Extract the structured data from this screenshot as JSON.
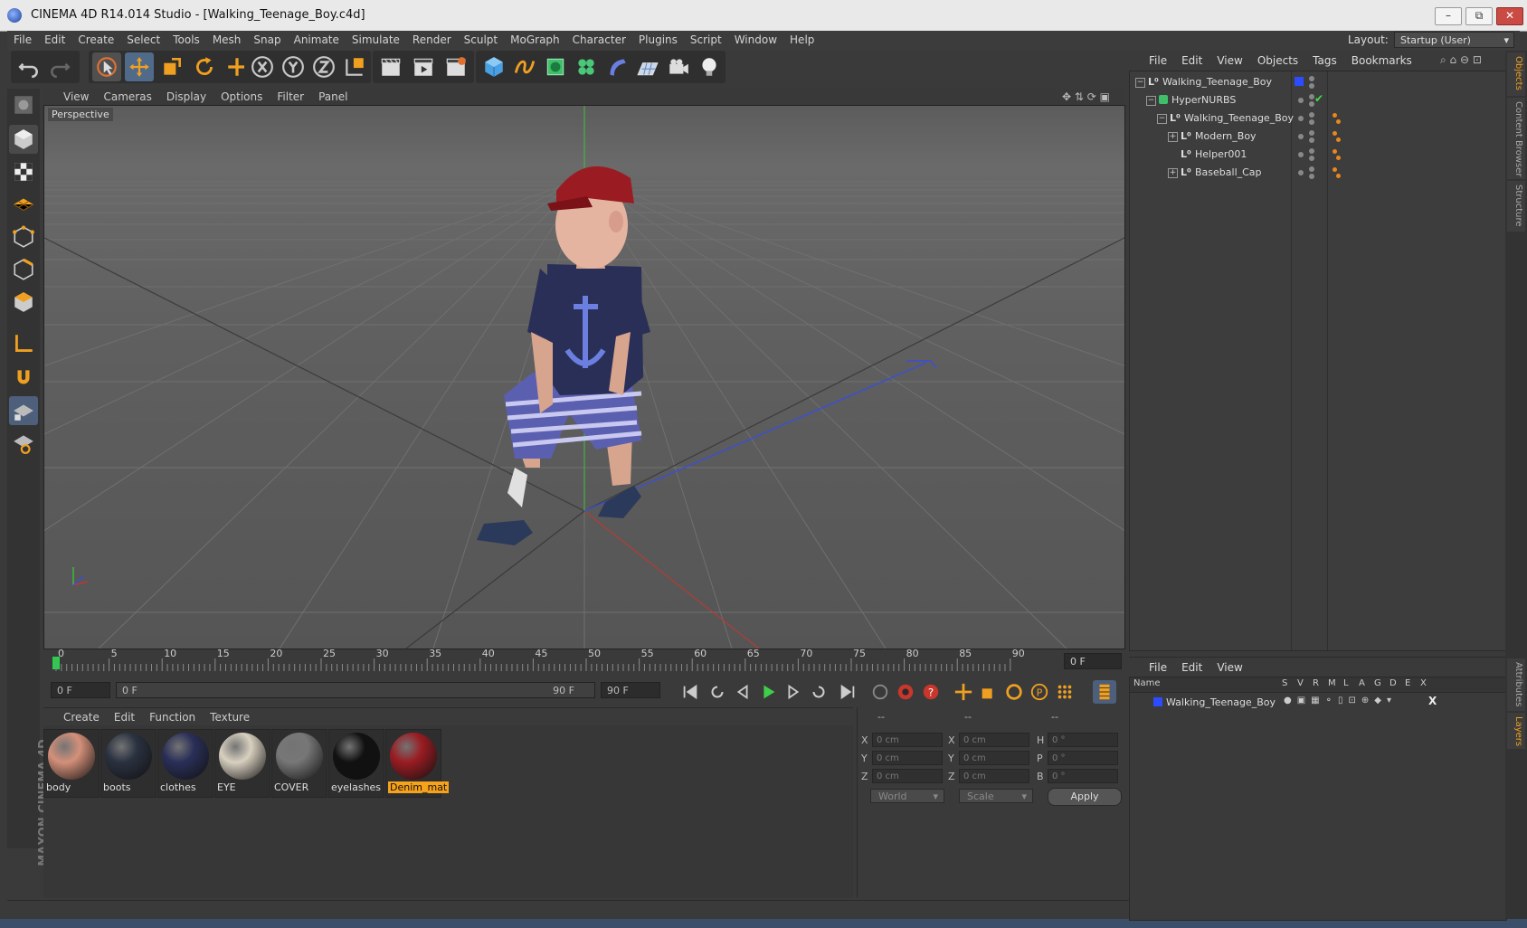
{
  "window": {
    "title": "CINEMA 4D R14.014 Studio - [Walking_Teenage_Boy.c4d]",
    "controls": [
      "–",
      "⧉",
      "✕"
    ]
  },
  "menu": [
    "File",
    "Edit",
    "Create",
    "Select",
    "Tools",
    "Mesh",
    "Snap",
    "Animate",
    "Simulate",
    "Render",
    "Sculpt",
    "MoGraph",
    "Character",
    "Plugins",
    "Script",
    "Window",
    "Help"
  ],
  "layout": {
    "label": "Layout:",
    "value": "Startup (User)"
  },
  "viewport": {
    "menu": [
      "View",
      "Cameras",
      "Display",
      "Options",
      "Filter",
      "Panel"
    ],
    "label": "Perspective"
  },
  "timeline": {
    "ticks": [
      "0",
      "5",
      "10",
      "15",
      "20",
      "25",
      "30",
      "35",
      "40",
      "45",
      "50",
      "55",
      "60",
      "65",
      "70",
      "75",
      "80",
      "85",
      "90"
    ],
    "current_frame": "0 F"
  },
  "transport": {
    "start": "0 F",
    "range_start": "0 F",
    "range_end": "90 F",
    "end": "90 F"
  },
  "materials": {
    "menu": [
      "Create",
      "Edit",
      "Function",
      "Texture"
    ],
    "items": [
      {
        "name": "body",
        "color": "#d4907a"
      },
      {
        "name": "boots",
        "color": "#2a3140"
      },
      {
        "name": "clothes",
        "color": "#2a2f58"
      },
      {
        "name": "EYE",
        "color": "#d8d0c0"
      },
      {
        "name": "COVER",
        "color": "#777777"
      },
      {
        "name": "eyelashes",
        "color": "#111111"
      },
      {
        "name": "Denim_mat",
        "color": "#9a1c22",
        "selected": true
      }
    ]
  },
  "coords": {
    "headers": [
      "--",
      "--",
      "--"
    ],
    "rows": [
      {
        "a": "X",
        "av": "0 cm",
        "b": "X",
        "bv": "0 cm",
        "c": "H",
        "cv": "0 °"
      },
      {
        "a": "Y",
        "av": "0 cm",
        "b": "Y",
        "bv": "0 cm",
        "c": "P",
        "cv": "0 °"
      },
      {
        "a": "Z",
        "av": "0 cm",
        "b": "Z",
        "bv": "0 cm",
        "c": "B",
        "cv": "0 °"
      }
    ],
    "space": "World",
    "mode": "Scale",
    "apply": "Apply"
  },
  "objects": {
    "menu": [
      "File",
      "Edit",
      "View",
      "Objects",
      "Tags",
      "Bookmarks"
    ],
    "tree": [
      {
        "name": "Walking_Teenage_Boy",
        "depth": 0
      },
      {
        "name": "HyperNURBS",
        "depth": 1
      },
      {
        "name": "Walking_Teenage_Boy",
        "depth": 2
      },
      {
        "name": "Modern_Boy",
        "depth": 3
      },
      {
        "name": "Helper001",
        "depth": 3
      },
      {
        "name": "Baseball_Cap",
        "depth": 3
      }
    ],
    "checkmark": "✔"
  },
  "layers": {
    "menu": [
      "File",
      "Edit",
      "View"
    ],
    "columns": [
      "Name",
      "S",
      "V",
      "R",
      "M",
      "L",
      "A",
      "G",
      "D",
      "E",
      "X"
    ],
    "rows": [
      {
        "name": "Walking_Teenage_Boy",
        "color": "#2d4cff"
      }
    ]
  },
  "side_tabs": [
    "Objects",
    "Content Browser",
    "Structure",
    "Attributes",
    "Layers"
  ],
  "branding": "MAXON CINEMA 4D",
  "colors": {
    "accent": "#f7a21b",
    "selection_blue": "#3a6fd8",
    "axis_x": "#c8362c",
    "axis_y": "#3fbf3f",
    "axis_z": "#3a4fd8"
  }
}
